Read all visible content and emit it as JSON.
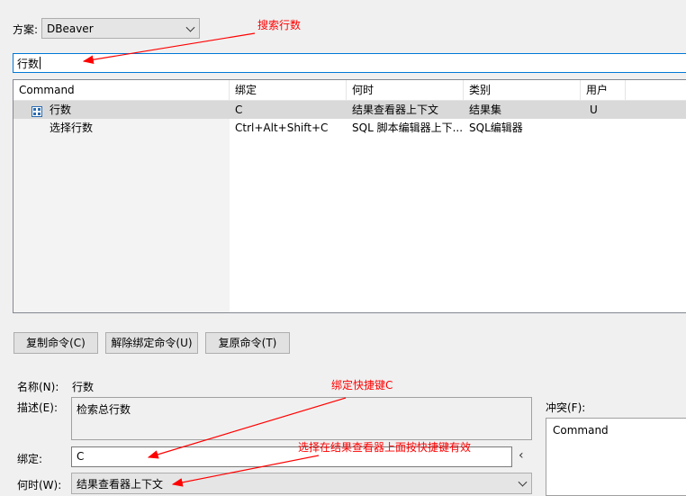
{
  "scheme": {
    "label": "方案:",
    "value": "DBeaver"
  },
  "filter": {
    "value": "行数"
  },
  "table": {
    "headers": [
      "Command",
      "绑定",
      "何时",
      "类别",
      "用户"
    ],
    "rows": [
      {
        "command": "行数",
        "binding": "C",
        "when": "结果查看器上下文",
        "category": "结果集",
        "user": "U",
        "selected": true
      },
      {
        "command": "选择行数",
        "binding": "Ctrl+Alt+Shift+C",
        "when": "SQL 脚本编辑器上下...",
        "category": "SQL编辑器",
        "user": "",
        "selected": false
      }
    ]
  },
  "buttons": {
    "copy": "复制命令(C)",
    "unbind": "解除绑定命令(U)",
    "restore": "复原命令(T)"
  },
  "details": {
    "name_label": "名称(N):",
    "name_value": "行数",
    "desc_label": "描述(E):",
    "desc_value": "检索总行数",
    "binding_label": "绑定:",
    "binding_value": "C",
    "when_label": "何时(W):",
    "when_value": "结果查看器上下文"
  },
  "conflicts": {
    "label": "冲突(F):",
    "header": "Command"
  },
  "annotations": {
    "search": "搜索行数",
    "bind": "绑定快捷键C",
    "context": "选择在结果查看器上面按快捷键有效"
  },
  "icons": {
    "row_icon": "grid-icon",
    "sort": "sort-up-icon",
    "dropdown": "chevron-down-icon",
    "collapse": "chevron-left-icon"
  },
  "colors": {
    "annotation": "#ff0000",
    "focus": "#0078d7",
    "selection": "#d9d9d9"
  }
}
